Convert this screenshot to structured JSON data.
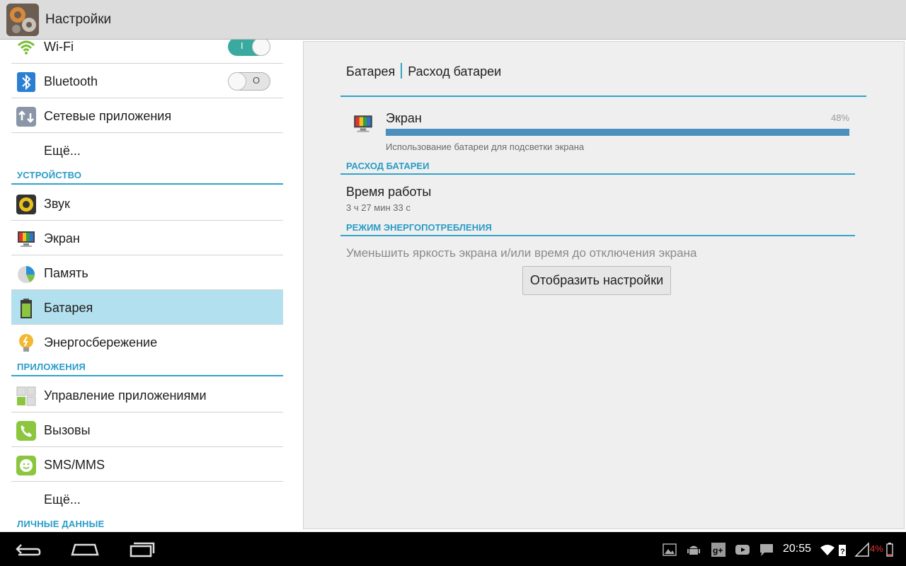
{
  "app": {
    "title": "Настройки"
  },
  "sidebar": {
    "items": [
      {
        "label": "Wi-Fi",
        "toggle_on_mark": "I"
      },
      {
        "label": "Bluetooth",
        "toggle_off_mark": "O"
      },
      {
        "label": "Сетевые приложения"
      },
      {
        "label": "Ещё..."
      },
      {
        "label": "Звук"
      },
      {
        "label": "Экран"
      },
      {
        "label": "Память"
      },
      {
        "label": "Батарея"
      },
      {
        "label": "Энергосбережение"
      },
      {
        "label": "Управление приложениями"
      },
      {
        "label": "Вызовы"
      },
      {
        "label": "SMS/MMS"
      },
      {
        "label": "Ещё..."
      }
    ],
    "sections": [
      "УСТРОЙСТВО",
      "ПРИЛОЖЕНИЯ",
      "ЛИЧНЫЕ ДАННЫЕ"
    ]
  },
  "content": {
    "breadcrumb": [
      "Батарея",
      "Расход батареи"
    ],
    "usage": {
      "name": "Экран",
      "percent_label": "48%",
      "percent": 48,
      "description": "Использование батареи для подсветки экрана"
    },
    "section_usage": "РАСХОД БАТАРЕИ",
    "runtime_label": "Время работы",
    "runtime_value": "3 ч 27 мин 33 с",
    "section_power": "РЕЖИМ ЭНЕРГОПОТРЕБЛЕНИЯ",
    "hint": "Уменьшить яркость экрана и/или время до отключения экрана",
    "button": "Отобразить настройки"
  },
  "statusbar": {
    "time": "20:55",
    "battery_percent": "4%",
    "icons": [
      "gallery-icon",
      "android-icon",
      "google-plus-icon",
      "youtube-icon",
      "chat-icon",
      "wifi-icon",
      "signal-icon",
      "battery-icon"
    ]
  },
  "colors": {
    "accent": "#33a3c9",
    "selected": "#b3e0ef",
    "toggle_on": "#3aa99f",
    "battery_low": "#e53030"
  }
}
